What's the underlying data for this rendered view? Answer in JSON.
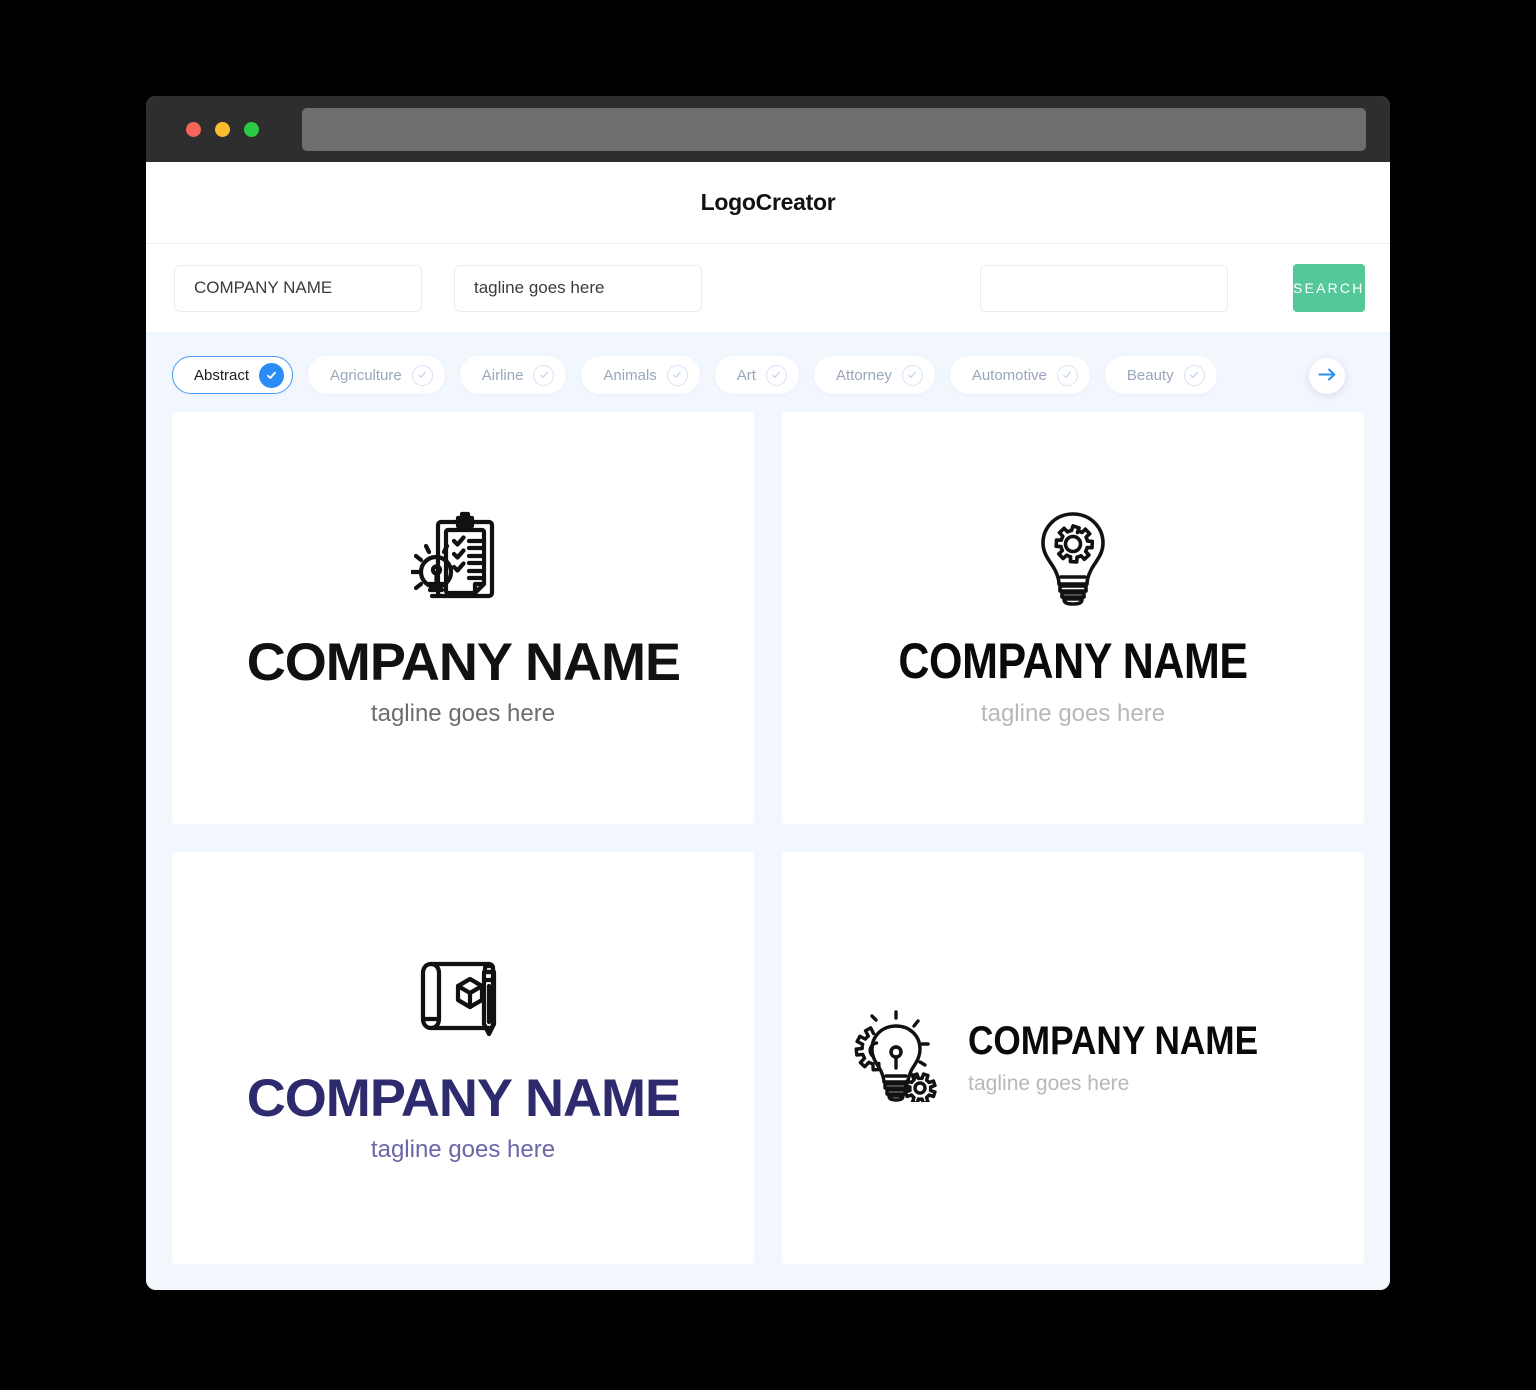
{
  "window": {
    "traffic_lights": [
      {
        "name": "close",
        "color": "#f7645a"
      },
      {
        "name": "minimize",
        "color": "#fbbd2e"
      },
      {
        "name": "maximize",
        "color": "#2acb42"
      }
    ],
    "url_value": ""
  },
  "header": {
    "brand": "LogoCreator"
  },
  "search": {
    "company_value": "COMPANY NAME",
    "company_placeholder": "COMPANY NAME",
    "tagline_value": "tagline goes here",
    "tagline_placeholder": "tagline goes here",
    "extra_value": "",
    "extra_placeholder": "",
    "button_label": "SEARCH",
    "button_color": "#55c89a"
  },
  "categories": {
    "selected": "Abstract",
    "accent_color": "#2b8cf5",
    "next_icon": "arrow-right-icon",
    "items": [
      {
        "label": "Abstract",
        "selected": true
      },
      {
        "label": "Agriculture",
        "selected": false
      },
      {
        "label": "Airline",
        "selected": false
      },
      {
        "label": "Animals",
        "selected": false
      },
      {
        "label": "Art",
        "selected": false
      },
      {
        "label": "Attorney",
        "selected": false
      },
      {
        "label": "Automotive",
        "selected": false
      },
      {
        "label": "Beauty",
        "selected": false
      }
    ]
  },
  "results": [
    {
      "icon": "clipboard-checklist-lightbulb-icon",
      "name": "COMPANY NAME",
      "tagline": "tagline goes here",
      "name_color": "#111111",
      "tagline_color": "#6d6d6d",
      "layout": "vertical"
    },
    {
      "icon": "lightbulb-gear-icon",
      "name": "COMPANY NAME",
      "tagline": "tagline goes here",
      "name_color": "#0a0a0a",
      "tagline_color": "#b8b8b8",
      "layout": "vertical"
    },
    {
      "icon": "blueprint-cube-pencil-icon",
      "name": "COMPANY NAME",
      "tagline": "tagline goes here",
      "name_color": "#2d2a6e",
      "tagline_color": "#6a66a8",
      "layout": "vertical"
    },
    {
      "icon": "lightbulb-gears-icon",
      "name": "COMPANY NAME",
      "tagline": "tagline goes here",
      "name_color": "#0a0a0a",
      "tagline_color": "#b8b8b8",
      "layout": "horizontal"
    }
  ]
}
